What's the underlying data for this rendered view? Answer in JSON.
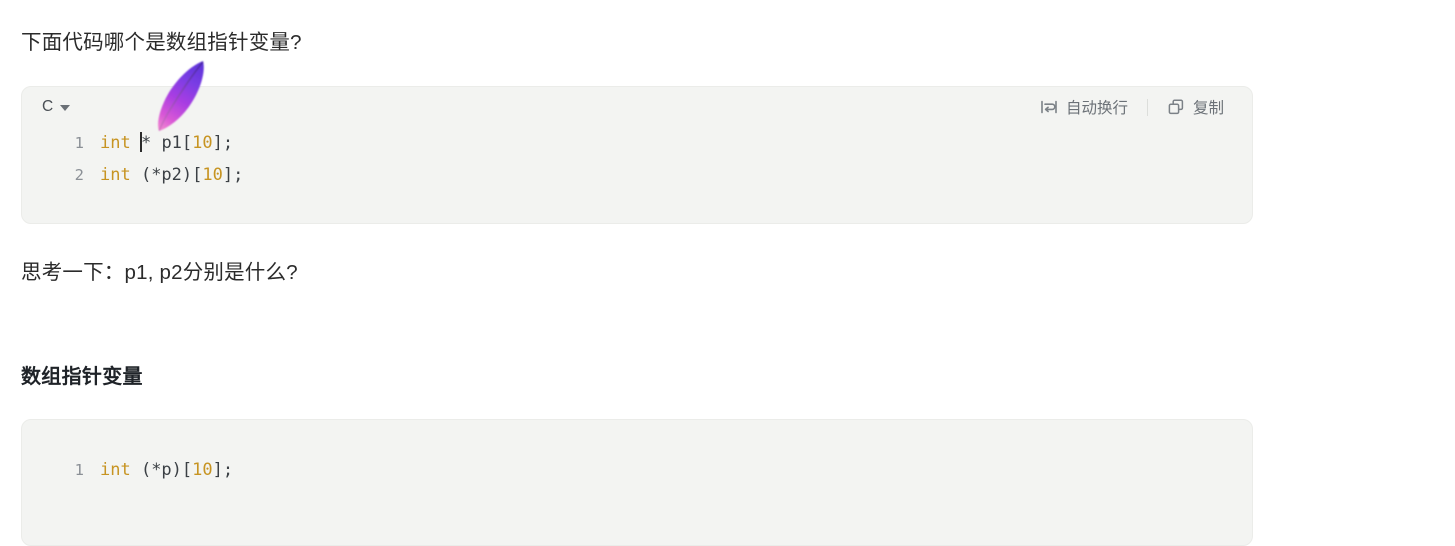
{
  "document": {
    "question": "下面代码哪个是数组指针变量?",
    "reflect": "思考一下：p1, p2分别是什么?",
    "section_heading": "数组指针变量"
  },
  "code_block_1": {
    "language": "C",
    "caret_icon": "chevron-down-icon",
    "actions": {
      "wrap_label": "自动换行",
      "wrap_icon": "word-wrap-icon",
      "copy_label": "复制",
      "copy_icon": "copy-icon"
    },
    "lines": [
      {
        "number": "1",
        "tokens": [
          {
            "text": "int",
            "type": "keyword"
          },
          {
            "text": " ",
            "type": "plain"
          },
          {
            "text": "caret",
            "type": "caret"
          },
          {
            "text": "* p1[",
            "type": "plain"
          },
          {
            "text": "10",
            "type": "number"
          },
          {
            "text": "];",
            "type": "plain"
          }
        ],
        "plain": "int * p1[10];"
      },
      {
        "number": "2",
        "tokens": [
          {
            "text": "int",
            "type": "keyword"
          },
          {
            "text": " (*p2)[",
            "type": "plain"
          },
          {
            "text": "10",
            "type": "number"
          },
          {
            "text": "];",
            "type": "plain"
          }
        ],
        "plain": "int (*p2)[10];"
      }
    ]
  },
  "code_block_2": {
    "lines": [
      {
        "number": "1",
        "tokens": [
          {
            "text": "int",
            "type": "keyword"
          },
          {
            "text": " (*p)[",
            "type": "plain"
          },
          {
            "text": "10",
            "type": "number"
          },
          {
            "text": "];",
            "type": "plain"
          }
        ],
        "plain": "int (*p)[10];"
      }
    ]
  },
  "cursor": {
    "icon": "feather-quill-cursor",
    "gradient_start": "#6b3fe0",
    "gradient_mid": "#a83ce0",
    "gradient_end": "#f06ad0"
  },
  "colors": {
    "page_background": "#ffffff",
    "code_background": "#f3f4f2",
    "code_border": "#ebece9",
    "keyword": "#c79422",
    "number": "#c79422",
    "identifier": "#3b4045",
    "gutter": "#8b9096",
    "header_text": "#6b7177",
    "body_text": "#2b2b2b"
  }
}
